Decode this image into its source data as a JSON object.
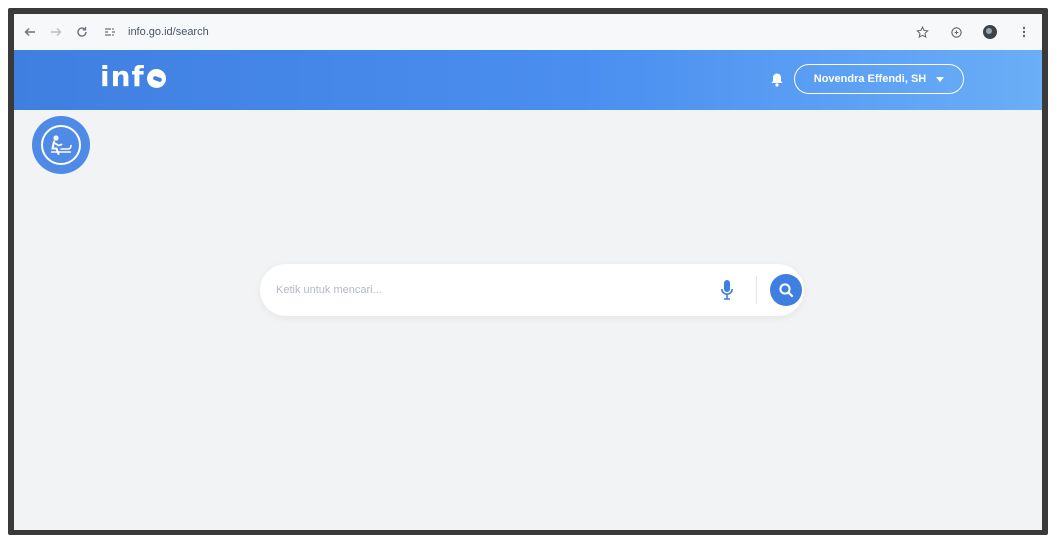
{
  "browser": {
    "back_icon": "arrow-left-icon",
    "forward_icon": "arrow-right-icon",
    "reload_icon": "reload-icon",
    "url": "info.go.id/search",
    "bookmark_icon": "star-icon",
    "extension_icon": "extension-icon",
    "menu_icon": "more-vert-icon"
  },
  "header": {
    "logo_text": "inf",
    "notification_icon": "bell-icon",
    "user_name": "Novendra Effendi, SH",
    "accent_color": "#3f7fe0"
  },
  "badge": {
    "icon": "person-desk-icon"
  },
  "search": {
    "placeholder": "Ketik untuk mencari...",
    "value": "",
    "mic_icon": "microphone-icon",
    "search_icon": "search-icon"
  }
}
